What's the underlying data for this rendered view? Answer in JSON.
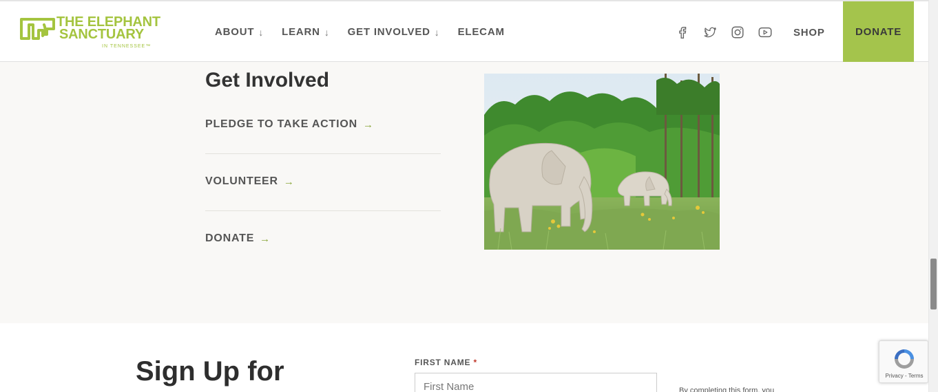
{
  "logo": {
    "line1": "THE ELEPHANT",
    "line2": "SANCTUARY",
    "line3": "IN TENNESSEE™",
    "color": "#a4c43f"
  },
  "nav": {
    "items": [
      {
        "label": "ABOUT",
        "has_dropdown": true
      },
      {
        "label": "LEARN",
        "has_dropdown": true
      },
      {
        "label": "GET INVOLVED",
        "has_dropdown": true
      },
      {
        "label": "ELECAM",
        "has_dropdown": false
      }
    ],
    "arrow": "↓"
  },
  "social": [
    "facebook-icon",
    "twitter-icon",
    "instagram-icon",
    "youtube-icon"
  ],
  "header": {
    "shop_label": "SHOP",
    "donate_label": "DONATE",
    "donate_color": "#a4c44c"
  },
  "get_involved": {
    "title": "Get Involved",
    "arrow": "→",
    "links": [
      {
        "label": "PLEDGE TO TAKE ACTION"
      },
      {
        "label": "VOLUNTEER"
      },
      {
        "label": "DONATE"
      }
    ]
  },
  "signup": {
    "title": "Sign Up for",
    "first_name_label": "FIRST NAME",
    "required_mark": "*",
    "first_name_placeholder": "First Name",
    "first_name_value": "",
    "form_note": "By completing this form, you"
  },
  "recaptcha": {
    "terms": "Privacy - Terms"
  }
}
